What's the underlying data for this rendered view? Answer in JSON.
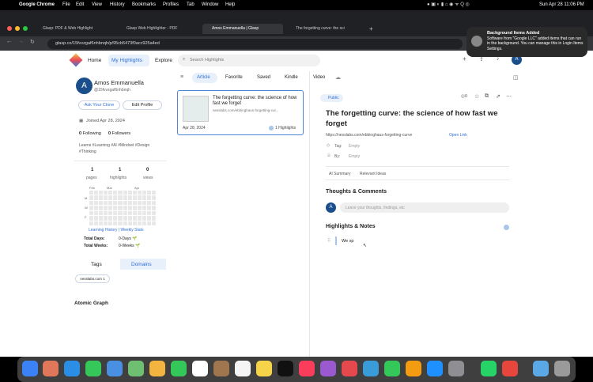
{
  "menubar": {
    "apple": "",
    "app": "Google Chrome",
    "items": [
      "File",
      "Edit",
      "View",
      "History",
      "Bookmarks",
      "Profiles",
      "Tab",
      "Window",
      "Help"
    ],
    "clock": "Sun Apr 28  11:06 PM"
  },
  "tabs": [
    {
      "label": "Glasp: PDF & Web Highlight"
    },
    {
      "label": "Glasp Web Highlighter - PDF"
    },
    {
      "label": "Amos Emmanuella | Glasp"
    },
    {
      "label": "The forgetting curve: the sci"
    }
  ],
  "url": "glasp.co/15fvvzgaf6nhbnqh/p/95cb5473f0acc925a4ed",
  "notification": {
    "title": "Background Items Added",
    "body": "Software from \"Google LLC\" added items that can run in the background. You can manage this in Login Items Settings."
  },
  "nav": {
    "home": "Home",
    "highlights": "My Highlights",
    "explore": "Explore",
    "search_placeholder": "Search Highlights"
  },
  "profile": {
    "avatar": "A",
    "name": "Amos Emmanuella",
    "handle": "@15fvvzgaf6nhbnqh",
    "ask_clone": "Ask Your Clone",
    "edit_profile": "Edit Profile",
    "joined": "Joined Apr 28, 2024",
    "following_count": "0",
    "following_label": "Following",
    "followers_count": "0",
    "followers_label": "Followers",
    "interests": "Learns #Learning #AI #Mindset #Design #Thinking",
    "stats": [
      {
        "num": "1",
        "label": "pages"
      },
      {
        "num": "1",
        "label": "highlights"
      },
      {
        "num": "0",
        "label": "views"
      }
    ],
    "months": [
      "Feb",
      "Mar",
      "Apr"
    ],
    "days": [
      "M",
      "W",
      "F"
    ],
    "heat_links": "Learning History | Weekly Stats",
    "total_days_label": "Total Days:",
    "total_days_value": "0-Days 🌱",
    "total_weeks_label": "Total Weeks:",
    "total_weeks_value": "0-Weeks 🌱",
    "tab_tags": "Tags",
    "tab_domains": "Domains",
    "domain_chip": "nesslabs.com 1",
    "atomic_graph": "Atomic Graph"
  },
  "filters": [
    "Article",
    "Favorite",
    "Saved",
    "Kindle",
    "Video"
  ],
  "card": {
    "title": "The forgetting curve: the science of how fast we forget",
    "url": "nesslabs.com/ebbinghaus-forgetting-cur...",
    "date": "Apr 28, 2024",
    "highlights": "1 Highlights"
  },
  "detail": {
    "public": "Public",
    "likes": "0",
    "title": "The forgetting curve: the science of how fast we forget",
    "url": "https://nesslabs.com/ebbinghaus-forgetting-curve",
    "open_link": "Open Link",
    "tag_label": "Tag:",
    "tag_value": "Empty",
    "by_label": "By:",
    "by_value": "Empty",
    "subtabs": [
      "AI Summary",
      "Relevant Ideas"
    ],
    "thoughts_title": "Thoughts & Comments",
    "comment_placeholder": "Leave your thoughts, findings, etc",
    "notes_title": "Highlights & Notes",
    "note_text": "We sp"
  },
  "colors": {
    "accent": "#1a4f8c",
    "brand_blue": "#2f6fd6"
  }
}
